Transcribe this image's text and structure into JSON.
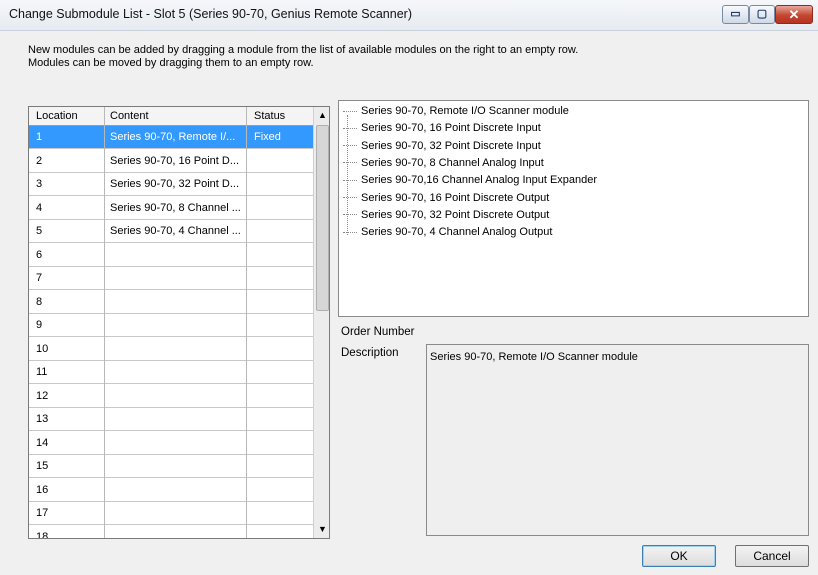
{
  "window": {
    "title": "Change Submodule List - Slot  5 (Series 90-70, Genius Remote Scanner)",
    "controls": {
      "minimize": "▭",
      "maximize": "▢",
      "close": "✕"
    }
  },
  "instructions": {
    "line1": "New modules can be added by dragging a module from the list of available modules on the right to an empty row.",
    "line2": "Modules can be moved by dragging them to an empty row."
  },
  "grid": {
    "columns": [
      "Location",
      "Content",
      "Status"
    ],
    "rows": [
      {
        "location": "1",
        "content": "Series 90-70, Remote I/...",
        "status": "Fixed"
      },
      {
        "location": "2",
        "content": "Series 90-70, 16 Point D...",
        "status": ""
      },
      {
        "location": "3",
        "content": "Series 90-70, 32 Point D...",
        "status": ""
      },
      {
        "location": "4",
        "content": "Series 90-70, 8 Channel ...",
        "status": ""
      },
      {
        "location": "5",
        "content": "Series 90-70, 4 Channel ...",
        "status": ""
      },
      {
        "location": "6",
        "content": "",
        "status": ""
      },
      {
        "location": "7",
        "content": "",
        "status": ""
      },
      {
        "location": "8",
        "content": "",
        "status": ""
      },
      {
        "location": "9",
        "content": "",
        "status": ""
      },
      {
        "location": "10",
        "content": "",
        "status": ""
      },
      {
        "location": "11",
        "content": "",
        "status": ""
      },
      {
        "location": "12",
        "content": "",
        "status": ""
      },
      {
        "location": "13",
        "content": "",
        "status": ""
      },
      {
        "location": "14",
        "content": "",
        "status": ""
      },
      {
        "location": "15",
        "content": "",
        "status": ""
      },
      {
        "location": "16",
        "content": "",
        "status": ""
      },
      {
        "location": "17",
        "content": "",
        "status": ""
      },
      {
        "location": "18",
        "content": "",
        "status": ""
      }
    ],
    "selected_row": 0,
    "scroll_up": "▲",
    "scroll_down": "▼"
  },
  "available_modules": [
    "Series 90-70, Remote I/O Scanner module",
    "Series 90-70, 16 Point Discrete Input",
    "Series 90-70, 32 Point Discrete Input",
    "Series 90-70, 8 Channel Analog Input",
    "Series 90-70,16 Channel Analog Input Expander",
    "Series 90-70, 16 Point Discrete Output",
    "Series 90-70, 32 Point Discrete Output",
    "Series 90-70, 4 Channel Analog Output"
  ],
  "details": {
    "order_number_label": "Order Number",
    "order_number_value": "",
    "description_label": "Description",
    "description_value": "Series 90-70, Remote I/O Scanner module"
  },
  "buttons": {
    "ok": "OK",
    "cancel": "Cancel"
  },
  "colors": {
    "selection": "#3399ff"
  }
}
